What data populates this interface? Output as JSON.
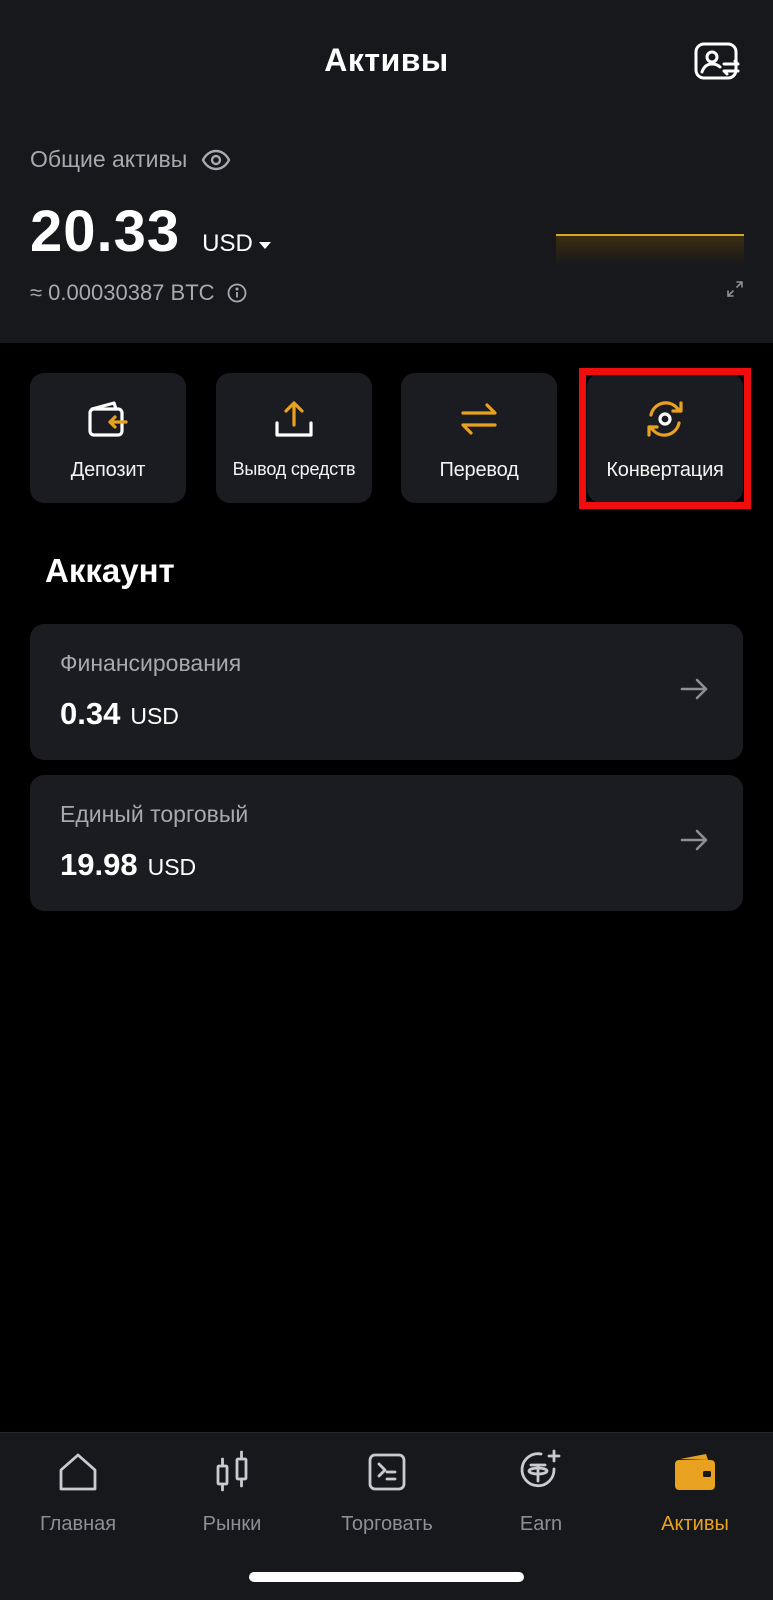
{
  "header": {
    "title": "Активы",
    "total_label": "Общие активы",
    "balance": "20.33",
    "currency": "USD",
    "btc_equivalent": "≈ 0.00030387 BTC"
  },
  "actions": [
    {
      "label": "Депозит",
      "icon": "deposit-icon"
    },
    {
      "label": "Вывод средств",
      "icon": "withdraw-icon"
    },
    {
      "label": "Перевод",
      "icon": "transfer-icon"
    },
    {
      "label": "Конвертация",
      "icon": "convert-icon",
      "highlighted": true
    }
  ],
  "account": {
    "title": "Аккаунт",
    "cards": [
      {
        "name": "Финансирования",
        "value": "0.34",
        "currency": "USD"
      },
      {
        "name": "Единый торговый",
        "value": "19.98",
        "currency": "USD"
      }
    ]
  },
  "bottom_nav": [
    {
      "label": "Главная",
      "icon": "home-icon"
    },
    {
      "label": "Рынки",
      "icon": "markets-icon"
    },
    {
      "label": "Торговать",
      "icon": "trade-icon"
    },
    {
      "label": "Earn",
      "icon": "earn-icon"
    },
    {
      "label": "Активы",
      "icon": "wallet-icon",
      "active": true
    }
  ],
  "colors": {
    "accent": "#e8a21f",
    "highlight_border": "#f00d0d",
    "header_bg": "#17181c",
    "card_bg": "#1b1c21"
  }
}
